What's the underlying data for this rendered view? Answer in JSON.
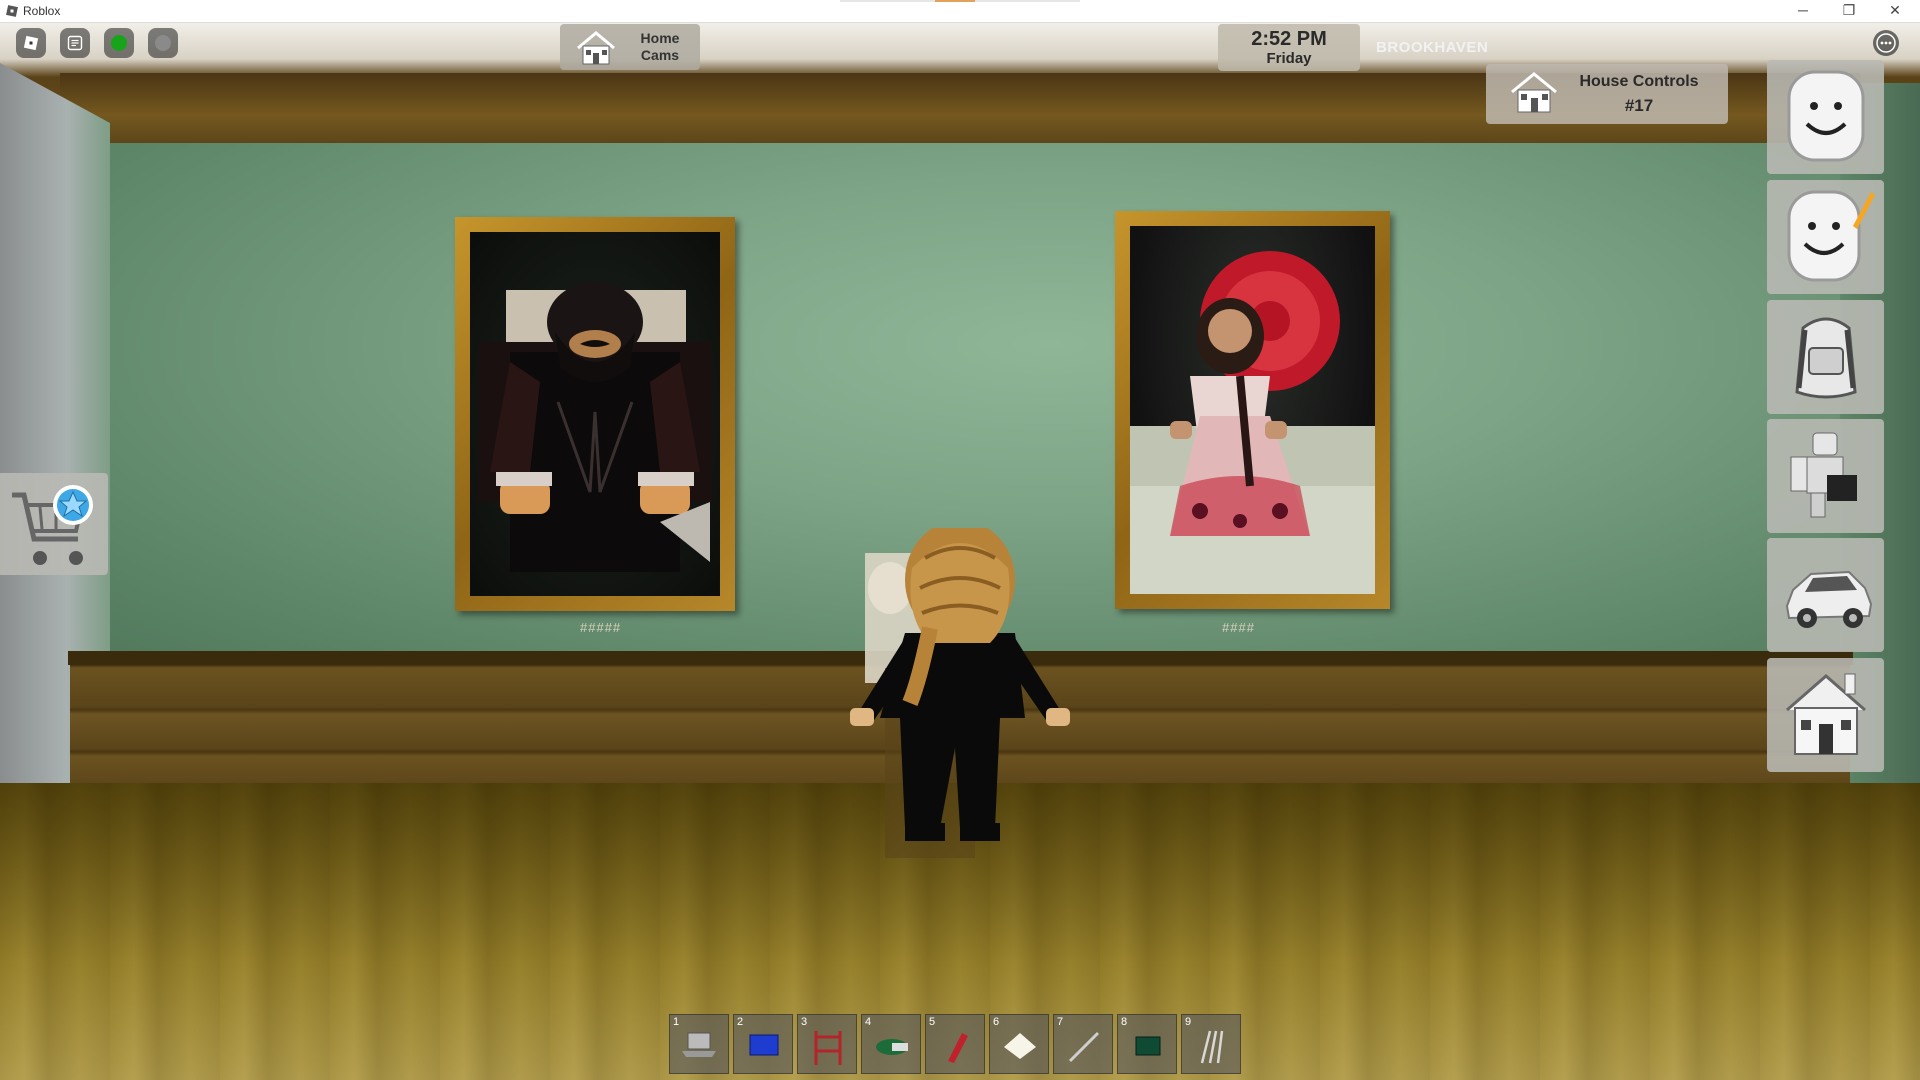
{
  "window": {
    "title": "Roblox",
    "minimize": "─",
    "maximize": "❐",
    "close": "✕"
  },
  "hud": {
    "home_cams": {
      "line1": "Home",
      "line2": "Cams"
    },
    "clock": {
      "time": "2:52 PM",
      "day": "Friday"
    },
    "location": "BROOKHAVEN",
    "house_controls": {
      "line1": "House Controls",
      "line2": "#17"
    }
  },
  "paintings": [
    {
      "plaque": "#####"
    },
    {
      "plaque": "####"
    }
  ],
  "side_menu": [
    "avatar-face",
    "avatar-edit",
    "backpack",
    "roleplay",
    "vehicle",
    "house"
  ],
  "hotbar": {
    "slots": [
      {
        "num": "1",
        "icon": "laptop-icon"
      },
      {
        "num": "2",
        "icon": "card-icon"
      },
      {
        "num": "3",
        "icon": "walker-icon"
      },
      {
        "num": "4",
        "icon": "cash-icon"
      },
      {
        "num": "5",
        "icon": "red-item-icon"
      },
      {
        "num": "6",
        "icon": "paper-icon"
      },
      {
        "num": "7",
        "icon": "knife-icon"
      },
      {
        "num": "8",
        "icon": "green-box-icon"
      },
      {
        "num": "9",
        "icon": "claws-icon"
      }
    ]
  },
  "colors": {
    "wall": "#7ea487",
    "floor": "#c2b25d",
    "wood": "#5a4419",
    "frame_gold": "#c6952c"
  }
}
